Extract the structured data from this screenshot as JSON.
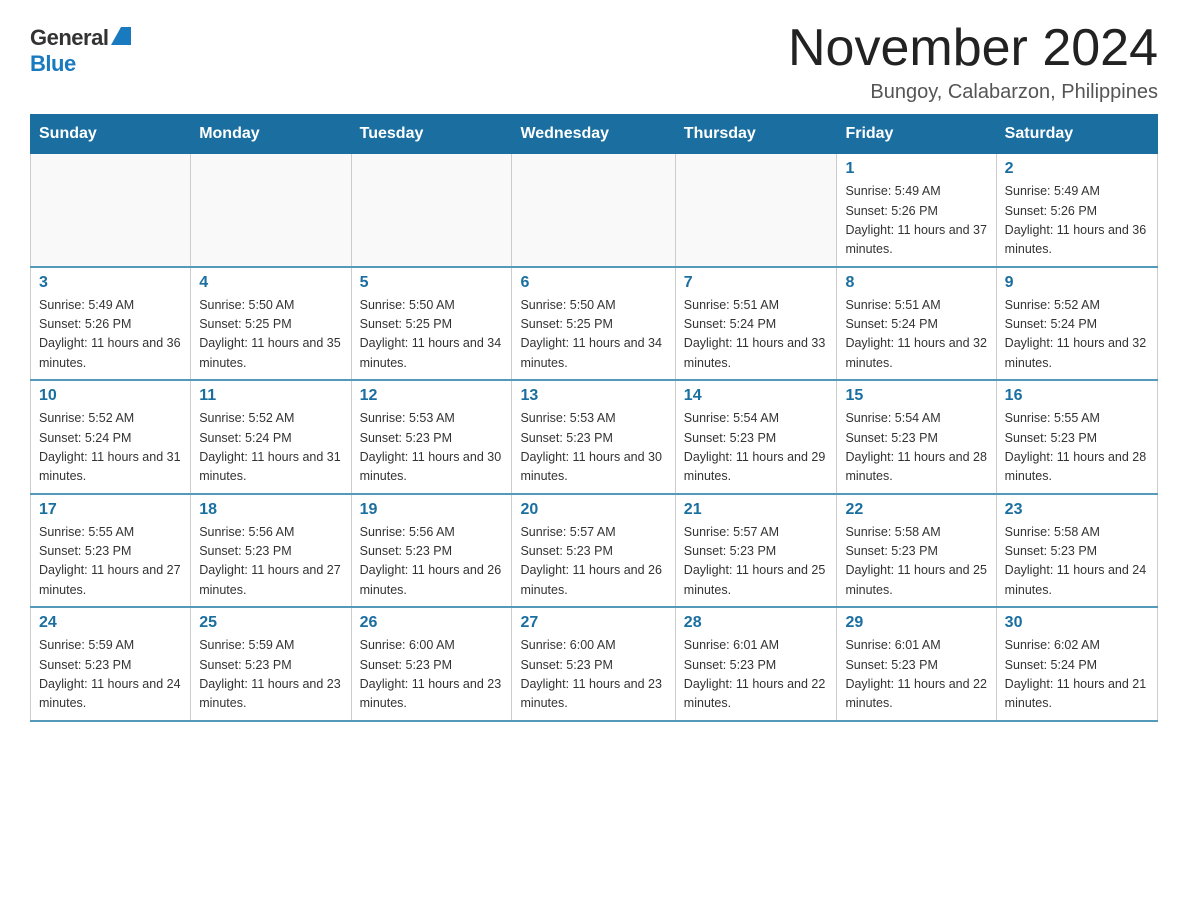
{
  "logo": {
    "general": "General",
    "blue": "Blue"
  },
  "title": "November 2024",
  "location": "Bungoy, Calabarzon, Philippines",
  "weekdays": [
    "Sunday",
    "Monday",
    "Tuesday",
    "Wednesday",
    "Thursday",
    "Friday",
    "Saturday"
  ],
  "weeks": [
    [
      {
        "day": "",
        "info": ""
      },
      {
        "day": "",
        "info": ""
      },
      {
        "day": "",
        "info": ""
      },
      {
        "day": "",
        "info": ""
      },
      {
        "day": "",
        "info": ""
      },
      {
        "day": "1",
        "info": "Sunrise: 5:49 AM\nSunset: 5:26 PM\nDaylight: 11 hours and 37 minutes."
      },
      {
        "day": "2",
        "info": "Sunrise: 5:49 AM\nSunset: 5:26 PM\nDaylight: 11 hours and 36 minutes."
      }
    ],
    [
      {
        "day": "3",
        "info": "Sunrise: 5:49 AM\nSunset: 5:26 PM\nDaylight: 11 hours and 36 minutes."
      },
      {
        "day": "4",
        "info": "Sunrise: 5:50 AM\nSunset: 5:25 PM\nDaylight: 11 hours and 35 minutes."
      },
      {
        "day": "5",
        "info": "Sunrise: 5:50 AM\nSunset: 5:25 PM\nDaylight: 11 hours and 34 minutes."
      },
      {
        "day": "6",
        "info": "Sunrise: 5:50 AM\nSunset: 5:25 PM\nDaylight: 11 hours and 34 minutes."
      },
      {
        "day": "7",
        "info": "Sunrise: 5:51 AM\nSunset: 5:24 PM\nDaylight: 11 hours and 33 minutes."
      },
      {
        "day": "8",
        "info": "Sunrise: 5:51 AM\nSunset: 5:24 PM\nDaylight: 11 hours and 32 minutes."
      },
      {
        "day": "9",
        "info": "Sunrise: 5:52 AM\nSunset: 5:24 PM\nDaylight: 11 hours and 32 minutes."
      }
    ],
    [
      {
        "day": "10",
        "info": "Sunrise: 5:52 AM\nSunset: 5:24 PM\nDaylight: 11 hours and 31 minutes."
      },
      {
        "day": "11",
        "info": "Sunrise: 5:52 AM\nSunset: 5:24 PM\nDaylight: 11 hours and 31 minutes."
      },
      {
        "day": "12",
        "info": "Sunrise: 5:53 AM\nSunset: 5:23 PM\nDaylight: 11 hours and 30 minutes."
      },
      {
        "day": "13",
        "info": "Sunrise: 5:53 AM\nSunset: 5:23 PM\nDaylight: 11 hours and 30 minutes."
      },
      {
        "day": "14",
        "info": "Sunrise: 5:54 AM\nSunset: 5:23 PM\nDaylight: 11 hours and 29 minutes."
      },
      {
        "day": "15",
        "info": "Sunrise: 5:54 AM\nSunset: 5:23 PM\nDaylight: 11 hours and 28 minutes."
      },
      {
        "day": "16",
        "info": "Sunrise: 5:55 AM\nSunset: 5:23 PM\nDaylight: 11 hours and 28 minutes."
      }
    ],
    [
      {
        "day": "17",
        "info": "Sunrise: 5:55 AM\nSunset: 5:23 PM\nDaylight: 11 hours and 27 minutes."
      },
      {
        "day": "18",
        "info": "Sunrise: 5:56 AM\nSunset: 5:23 PM\nDaylight: 11 hours and 27 minutes."
      },
      {
        "day": "19",
        "info": "Sunrise: 5:56 AM\nSunset: 5:23 PM\nDaylight: 11 hours and 26 minutes."
      },
      {
        "day": "20",
        "info": "Sunrise: 5:57 AM\nSunset: 5:23 PM\nDaylight: 11 hours and 26 minutes."
      },
      {
        "day": "21",
        "info": "Sunrise: 5:57 AM\nSunset: 5:23 PM\nDaylight: 11 hours and 25 minutes."
      },
      {
        "day": "22",
        "info": "Sunrise: 5:58 AM\nSunset: 5:23 PM\nDaylight: 11 hours and 25 minutes."
      },
      {
        "day": "23",
        "info": "Sunrise: 5:58 AM\nSunset: 5:23 PM\nDaylight: 11 hours and 24 minutes."
      }
    ],
    [
      {
        "day": "24",
        "info": "Sunrise: 5:59 AM\nSunset: 5:23 PM\nDaylight: 11 hours and 24 minutes."
      },
      {
        "day": "25",
        "info": "Sunrise: 5:59 AM\nSunset: 5:23 PM\nDaylight: 11 hours and 23 minutes."
      },
      {
        "day": "26",
        "info": "Sunrise: 6:00 AM\nSunset: 5:23 PM\nDaylight: 11 hours and 23 minutes."
      },
      {
        "day": "27",
        "info": "Sunrise: 6:00 AM\nSunset: 5:23 PM\nDaylight: 11 hours and 23 minutes."
      },
      {
        "day": "28",
        "info": "Sunrise: 6:01 AM\nSunset: 5:23 PM\nDaylight: 11 hours and 22 minutes."
      },
      {
        "day": "29",
        "info": "Sunrise: 6:01 AM\nSunset: 5:23 PM\nDaylight: 11 hours and 22 minutes."
      },
      {
        "day": "30",
        "info": "Sunrise: 6:02 AM\nSunset: 5:24 PM\nDaylight: 11 hours and 21 minutes."
      }
    ]
  ]
}
